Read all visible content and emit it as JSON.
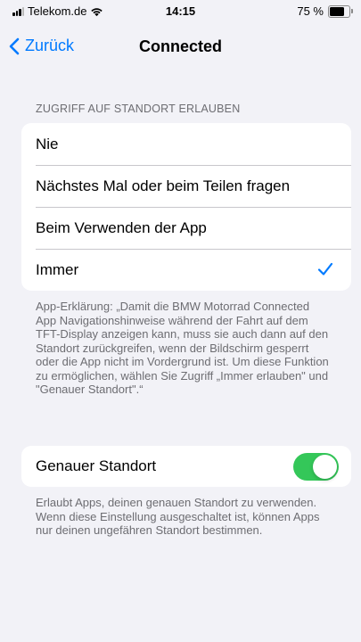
{
  "status_bar": {
    "carrier": "Telekom.de",
    "time": "14:15",
    "battery_percent": "75 %",
    "battery_level": 0.75,
    "icons": [
      "signal-icon",
      "wifi-icon",
      "battery-icon"
    ]
  },
  "nav": {
    "back_label": "Zurück",
    "title": "Connected"
  },
  "location_access": {
    "header": "ZUGRIFF AUF STANDORT ERLAUBEN",
    "options": [
      {
        "label": "Nie",
        "selected": false
      },
      {
        "label": "Nächstes Mal oder beim Teilen fragen",
        "selected": false
      },
      {
        "label": "Beim Verwenden der App",
        "selected": false
      },
      {
        "label": "Immer",
        "selected": true
      }
    ],
    "explanation": "App-Erklärung: „Damit die BMW Motorrad Connected App Navigationshinweise während der Fahrt auf dem TFT-Display anzeigen kann, muss sie auch dann auf den Standort zurückgreifen, wenn der Bildschirm gesperrt oder die App nicht im Vordergrund ist. Um diese Funktion zu ermöglichen, wählen Sie Zugriff „Immer erlauben\" und \"Genauer Standort\".“"
  },
  "precise_location": {
    "label": "Genauer Standort",
    "enabled": true,
    "footer": "Erlaubt Apps, deinen genauen Standort zu verwenden. Wenn diese Einstellung ausgeschaltet ist, können Apps nur deinen ungefähren Standort bestimmen."
  },
  "colors": {
    "accent": "#007aff",
    "toggle_on": "#34c759",
    "background": "#f2f2f7",
    "secondary_text": "#6d6d72"
  }
}
